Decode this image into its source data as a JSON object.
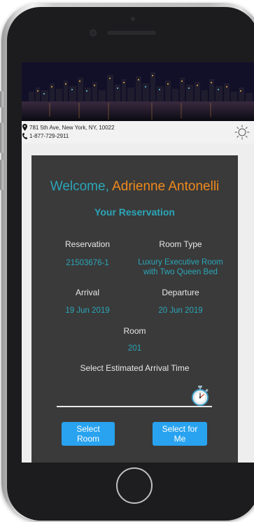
{
  "location": {
    "address": "781 5th Ave, New York, NY, 10022",
    "phone": "1-877-729-2911"
  },
  "icons": {
    "location": "map-pin-icon",
    "phone": "phone-icon",
    "theme": "sun-icon",
    "time": "stopwatch-icon"
  },
  "welcome": {
    "prefix": "Welcome,",
    "guest_name": "Adrienne Antonelli"
  },
  "reservation": {
    "heading": "Your Reservation",
    "reservation_label": "Reservation",
    "reservation_value": "21503676-1",
    "room_type_label": "Room Type",
    "room_type_value_line1": "Luxury Executive Room",
    "room_type_value_line2": "with Two Queen Bed",
    "arrival_label": "Arrival",
    "arrival_value": "19 Jun 2019",
    "departure_label": "Departure",
    "departure_value": "20 Jun 2019",
    "room_label": "Room",
    "room_value": "201",
    "arrival_time_label": "Select Estimated Arrival Time",
    "arrival_time_value": ""
  },
  "actions": {
    "select_room": "Select Room",
    "select_for_me": "Select for Me"
  },
  "colors": {
    "accent_teal": "#2aa6b8",
    "accent_orange": "#f08a1c",
    "button_blue": "#29a3f0",
    "card_bg": "#3a3a3a"
  }
}
